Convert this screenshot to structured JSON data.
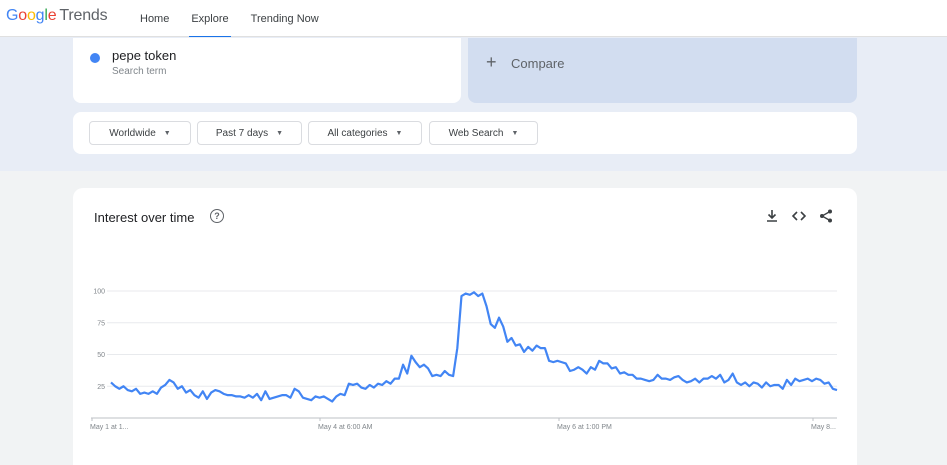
{
  "header": {
    "logo_google": "Google",
    "logo_trends": "Trends",
    "nav": [
      {
        "label": "Home"
      },
      {
        "label": "Explore"
      },
      {
        "label": "Trending Now"
      }
    ]
  },
  "search": {
    "term": "pepe token",
    "term_type": "Search term",
    "compare_label": "Compare"
  },
  "filters": [
    {
      "label": "Worldwide"
    },
    {
      "label": "Past 7 days"
    },
    {
      "label": "All categories"
    },
    {
      "label": "Web Search"
    }
  ],
  "chart_panel": {
    "title": "Interest over time",
    "icons": [
      "help-icon",
      "download-icon",
      "embed-code-icon",
      "share-icon"
    ]
  },
  "chart_data": {
    "type": "line",
    "title": "Interest over time",
    "xlabel": "",
    "ylabel": "",
    "ylim": [
      0,
      100
    ],
    "y_ticks": [
      25,
      50,
      75,
      100
    ],
    "x_tick_labels": [
      "May 1 at 1...",
      "May 4 at 6:00 AM",
      "May 6 at 1:00 PM",
      "May 8..."
    ],
    "grid": true,
    "color": "#4285f4",
    "series": [
      {
        "values": [
          28,
          25,
          23,
          25,
          22,
          21,
          23,
          19,
          20,
          19,
          21,
          19,
          24,
          26,
          30,
          28,
          23,
          25,
          20,
          22,
          18,
          16,
          21,
          15,
          20,
          22,
          21,
          19,
          18,
          18,
          17,
          17,
          16,
          18,
          16,
          19,
          14,
          21,
          15,
          16,
          17,
          18,
          18,
          16,
          23,
          21,
          16,
          15,
          14,
          17,
          16,
          17,
          15,
          13,
          17,
          19,
          18,
          27,
          26,
          27,
          24,
          23,
          26,
          24,
          27,
          26,
          29,
          27,
          31,
          31,
          42,
          35,
          49,
          44,
          40,
          42,
          39,
          33,
          34,
          33,
          37,
          34,
          33,
          55,
          96,
          98,
          97,
          99,
          96,
          98,
          88,
          74,
          71,
          79,
          72,
          60,
          63,
          57,
          58,
          52,
          56,
          53,
          57,
          55,
          55,
          45,
          44,
          45,
          44,
          43,
          37,
          38,
          40,
          38,
          35,
          40,
          38,
          45,
          43,
          43,
          39,
          40,
          35,
          36,
          34,
          34,
          31,
          31,
          30,
          29,
          30,
          34,
          31,
          31,
          30,
          32,
          33,
          30,
          28,
          29,
          31,
          28,
          31,
          31,
          33,
          31,
          34,
          28,
          30,
          35,
          28,
          26,
          28,
          25,
          28,
          27,
          24,
          28,
          25,
          26,
          26,
          23,
          30,
          26,
          31,
          29,
          30,
          31,
          29,
          31,
          30,
          27,
          28,
          23,
          22
        ]
      }
    ]
  }
}
